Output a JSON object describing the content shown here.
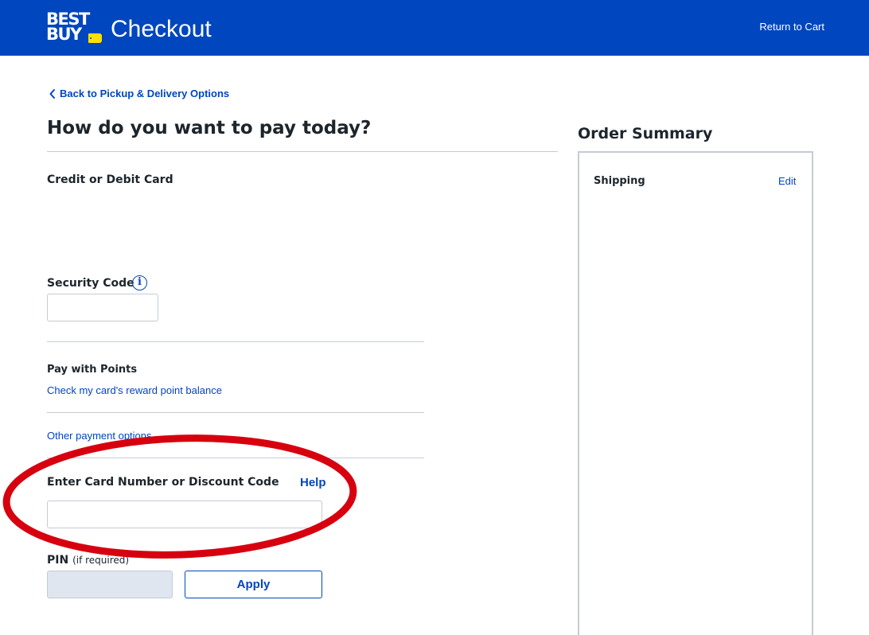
{
  "header": {
    "logo": {
      "line1": "BEST",
      "line2": "BUY"
    },
    "title": "Checkout",
    "return_link": "Return to Cart"
  },
  "back_link": "Back to Pickup & Delivery Options",
  "page_title": "How do you want to pay today?",
  "payment": {
    "card_section_label": "Credit or Debit Card",
    "security_code": {
      "label": "Security Code",
      "value": "",
      "info_icon": "info-icon"
    },
    "points": {
      "label": "Pay with Points",
      "link": "Check my card's reward point balance"
    },
    "other_options_link": "Other payment options",
    "gift_card": {
      "label": "Enter Card Number or Discount Code",
      "help": "Help",
      "value": ""
    },
    "pin": {
      "label": "PIN",
      "sublabel": "(if required)",
      "value": ""
    },
    "apply_button": "Apply"
  },
  "order_summary": {
    "title": "Order Summary",
    "shipping_label": "Shipping",
    "edit_link": "Edit"
  },
  "colors": {
    "brand_blue": "#0046be",
    "brand_yellow": "#ffe000",
    "annotation_red": "#d7000f",
    "border_gray": "#c5cbd5"
  }
}
